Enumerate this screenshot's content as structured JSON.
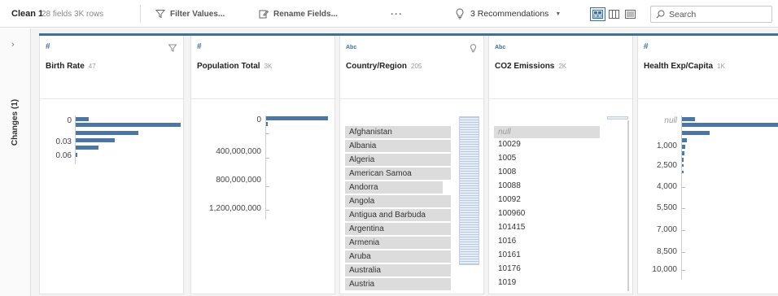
{
  "toolbar": {
    "step_name": "Clean 1",
    "step_meta": "28 fields  3K rows",
    "filter_label": "Filter Values...",
    "rename_label": "Rename Fields...",
    "more_label": "···",
    "recommendations_label": "3 Recommendations",
    "search_placeholder": "Search"
  },
  "rail": {
    "changes_label": "Changes (1)"
  },
  "cards": {
    "birth_rate": {
      "type": "#",
      "title": "Birth Rate",
      "count": "47",
      "axis": [
        "0",
        "0.03",
        "0.06"
      ]
    },
    "population": {
      "type": "#",
      "title": "Population Total",
      "count": "3K",
      "axis": [
        "0",
        "400,000,000",
        "800,000,000",
        "1,200,000,000"
      ]
    },
    "country": {
      "type": "Abc",
      "title": "Country/Region",
      "count": "205",
      "values": [
        "Afghanistan",
        "Albania",
        "Algeria",
        "American Samoa",
        "Andorra",
        "Angola",
        "Antigua and Barbuda",
        "Argentina",
        "Armenia",
        "Aruba",
        "Australia",
        "Austria"
      ]
    },
    "co2": {
      "type": "Abc",
      "title": "CO2 Emissions",
      "count": "2K",
      "values": [
        "null",
        "10029",
        "1005",
        "1008",
        "10088",
        "10092",
        "100960",
        "101415",
        "1016",
        "10161",
        "10176",
        "1019"
      ]
    },
    "health": {
      "type": "#",
      "title": "Health Exp/Capita",
      "count": "1K",
      "axis": [
        "null",
        "1,000",
        "2,500",
        "4,000",
        "5,500",
        "7,000",
        "8,500",
        "10,000"
      ]
    }
  },
  "colors": {
    "accent": "#3d6fa1",
    "bar": "#4a76a8",
    "category_bg": "#dcdcdc"
  }
}
